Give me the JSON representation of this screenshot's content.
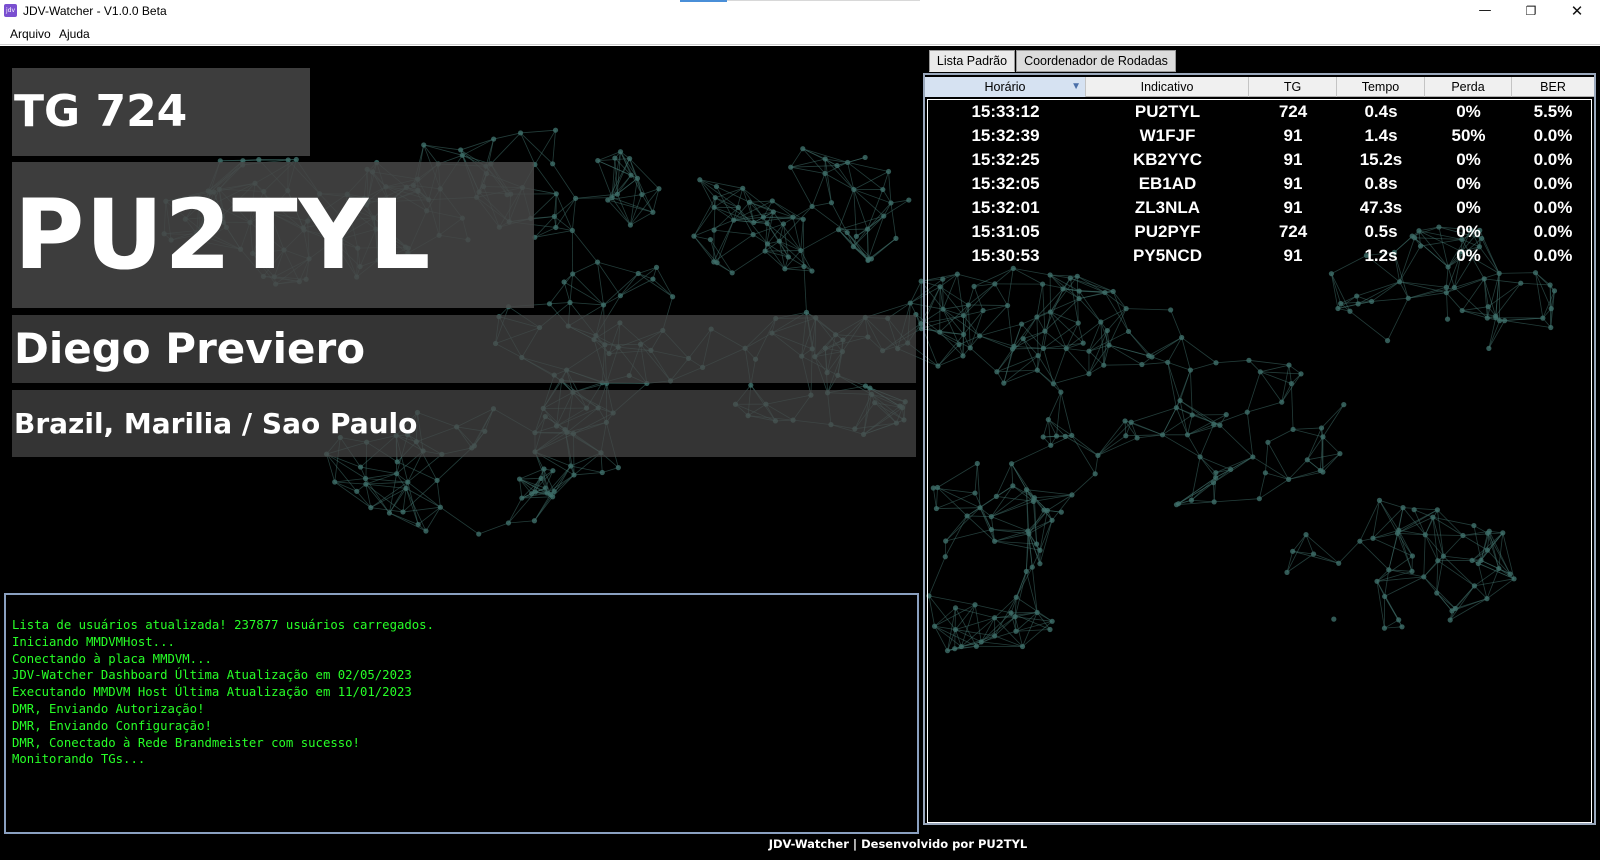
{
  "window": {
    "title": "JDV-Watcher  - V1.0.0 Beta",
    "icon_label": "jdv",
    "controls": {
      "minimize": "—",
      "maximize": "❐",
      "close": "✕"
    }
  },
  "menu": {
    "items": [
      "Arquivo",
      "Ajuda"
    ]
  },
  "current": {
    "tg": "TG 724",
    "callsign": "PU2TYL",
    "name": "Diego Previero",
    "location": "Brazil, Marilia / Sao Paulo"
  },
  "log": {
    "lines": [
      "Lista de usuários atualizada! 237877 usuários carregados.",
      "Iniciando MMDVMHost...",
      "Conectando à placa MMDVM...",
      "JDV-Watcher Dashboard Última Atualização em 02/05/2023",
      "Executando MMDVM Host Última Atualização em 11/01/2023",
      "DMR, Enviando Autorização!",
      "DMR, Enviando Configuração!",
      "DMR, Conectado à Rede Brandmeister com sucesso!",
      "Monitorando TGs..."
    ]
  },
  "footer": {
    "text": "JDV-Watcher | Desenvolvido por PU2TYL"
  },
  "tabs": [
    "Lista Padrão",
    "Coordenador de Rodadas"
  ],
  "table": {
    "columns": [
      "Horário",
      "Indicativo",
      "TG",
      "Tempo",
      "Perda",
      "BER"
    ],
    "sort_indicator": "▼",
    "rows": [
      [
        "15:33:12",
        "PU2TYL",
        "724",
        "0.4s",
        "0%",
        "5.5%"
      ],
      [
        "15:32:39",
        "W1FJF",
        "91",
        "1.4s",
        "50%",
        "0.0%"
      ],
      [
        "15:32:25",
        "KB2YYC",
        "91",
        "15.2s",
        "0%",
        "0.0%"
      ],
      [
        "15:32:05",
        "EB1AD",
        "91",
        "0.8s",
        "0%",
        "0.0%"
      ],
      [
        "15:32:01",
        "ZL3NLA",
        "91",
        "47.3s",
        "0%",
        "0.0%"
      ],
      [
        "15:31:05",
        "PU2PYF",
        "724",
        "0.5s",
        "0%",
        "0.0%"
      ],
      [
        "15:30:53",
        "PY5NCD",
        "91",
        "1.2s",
        "0%",
        "0.0%"
      ]
    ]
  },
  "colors": {
    "log_text": "#27ff27",
    "network": "#3f6f6a",
    "panel_bg": "#484848"
  }
}
